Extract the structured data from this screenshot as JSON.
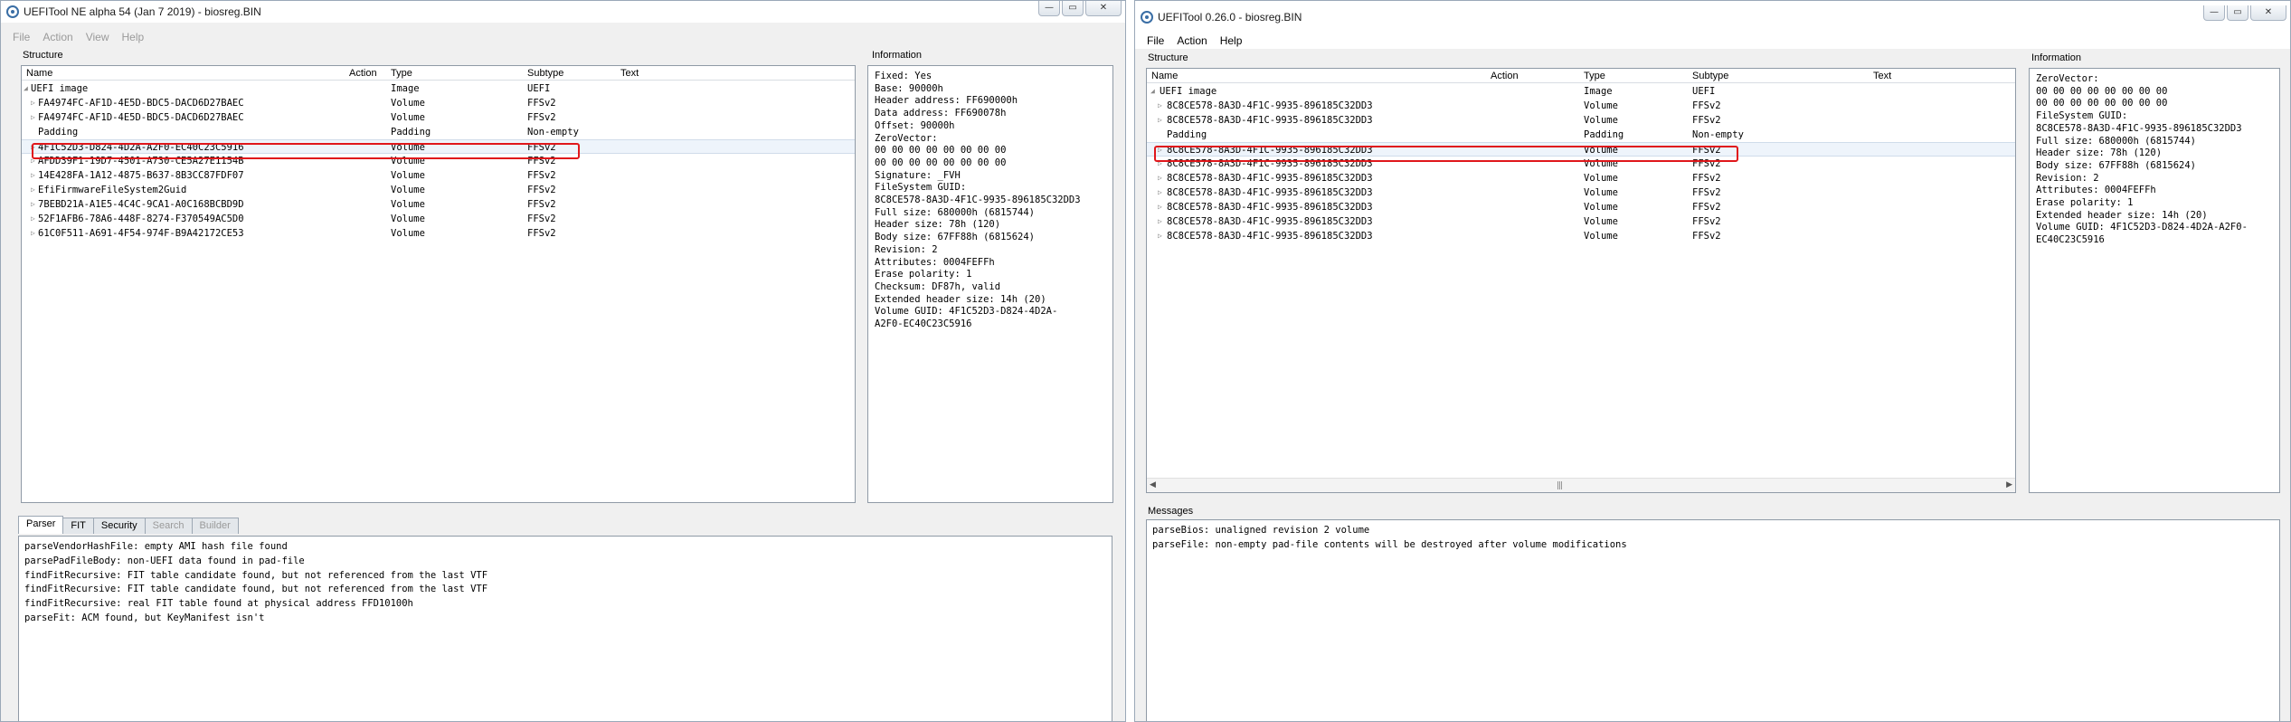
{
  "left": {
    "title": "UEFITool NE alpha 54 (Jan  7 2019) - biosreg.BIN",
    "menu": [
      "File",
      "Action",
      "View",
      "Help"
    ],
    "structure_label": "Structure",
    "information_label": "Information",
    "columns": [
      "Name",
      "Action",
      "Type",
      "Subtype",
      "Text"
    ],
    "rows": [
      {
        "name": "UEFI image",
        "type": "Image",
        "subtype": "UEFI",
        "expander": "◢"
      },
      {
        "name": "FA4974FC-AF1D-4E5D-BDC5-DACD6D27BAEC",
        "type": "Volume",
        "subtype": "FFSv2",
        "expander": "▷"
      },
      {
        "name": "FA4974FC-AF1D-4E5D-BDC5-DACD6D27BAEC",
        "type": "Volume",
        "subtype": "FFSv2",
        "expander": "▷"
      },
      {
        "name": "Padding",
        "type": "Padding",
        "subtype": "Non-empty",
        "expander": ""
      },
      {
        "name": "4F1C52D3-D824-4D2A-A2F0-EC40C23C5916",
        "type": "Volume",
        "subtype": "FFSv2",
        "expander": "▷"
      },
      {
        "name": "AFDD39F1-19D7-4501-A730-CE5A27E1154B",
        "type": "Volume",
        "subtype": "FFSv2",
        "expander": "▷"
      },
      {
        "name": "14E428FA-1A12-4875-B637-8B3CC87FDF07",
        "type": "Volume",
        "subtype": "FFSv2",
        "expander": "▷"
      },
      {
        "name": "EfiFirmwareFileSystem2Guid",
        "type": "Volume",
        "subtype": "FFSv2",
        "expander": "▷"
      },
      {
        "name": "7BEBD21A-A1E5-4C4C-9CA1-A0C168BCBD9D",
        "type": "Volume",
        "subtype": "FFSv2",
        "expander": "▷"
      },
      {
        "name": "52F1AFB6-78A6-448F-8274-F370549AC5D0",
        "type": "Volume",
        "subtype": "FFSv2",
        "expander": "▷"
      },
      {
        "name": "61C0F511-A691-4F54-974F-B9A42172CE53",
        "type": "Volume",
        "subtype": "FFSv2",
        "expander": "▷"
      }
    ],
    "info_lines": [
      "Fixed: Yes",
      "Base: 90000h",
      "Header address: FF690000h",
      "Data address: FF690078h",
      "Offset: 90000h",
      "ZeroVector:",
      "00 00 00 00 00 00 00 00",
      "00 00 00 00 00 00 00 00",
      "Signature: _FVH",
      "FileSystem GUID:",
      "8C8CE578-8A3D-4F1C-9935-896185C32DD3",
      "Full size: 680000h (6815744)",
      "Header size: 78h (120)",
      "Body size: 67FF88h (6815624)",
      "Revision: 2",
      "Attributes: 0004FEFFh",
      "Erase polarity: 1",
      "Checksum: DF87h, valid",
      "Extended header size: 14h (20)",
      "Volume GUID: 4F1C52D3-D824-4D2A-",
      "A2F0-EC40C23C5916"
    ],
    "tabs": [
      {
        "label": "Parser",
        "state": "active"
      },
      {
        "label": "FIT",
        "state": "normal"
      },
      {
        "label": "Security",
        "state": "normal"
      },
      {
        "label": "Search",
        "state": "disabled"
      },
      {
        "label": "Builder",
        "state": "disabled"
      }
    ],
    "messages": [
      "parseVendorHashFile: empty AMI hash file found",
      "parsePadFileBody: non-UEFI data found in pad-file",
      "findFitRecursive: FIT table candidate found, but not referenced from the last VTF",
      "findFitRecursive: FIT table candidate found, but not referenced from the last VTF",
      "findFitRecursive: real FIT table found at physical address FFD10100h",
      "parseFit: ACM found, but KeyManifest isn't"
    ]
  },
  "right": {
    "title": "UEFITool 0.26.0 - biosreg.BIN",
    "menu": [
      "File",
      "Action",
      "Help"
    ],
    "structure_label": "Structure",
    "information_label": "Information",
    "messages_label": "Messages",
    "columns": [
      "Name",
      "Action",
      "Type",
      "Subtype",
      "Text"
    ],
    "rows": [
      {
        "name": "UEFI image",
        "type": "Image",
        "subtype": "UEFI",
        "expander": "◢"
      },
      {
        "name": "8C8CE578-8A3D-4F1C-9935-896185C32DD3",
        "type": "Volume",
        "subtype": "FFSv2",
        "expander": "▷"
      },
      {
        "name": "8C8CE578-8A3D-4F1C-9935-896185C32DD3",
        "type": "Volume",
        "subtype": "FFSv2",
        "expander": "▷"
      },
      {
        "name": "Padding",
        "type": "Padding",
        "subtype": "Non-empty",
        "expander": ""
      },
      {
        "name": "8C8CE578-8A3D-4F1C-9935-896185C32DD3",
        "type": "Volume",
        "subtype": "FFSv2",
        "expander": "▷"
      },
      {
        "name": "8C8CE578-8A3D-4F1C-9935-896185C32DD3",
        "type": "Volume",
        "subtype": "FFSv2",
        "expander": "▷"
      },
      {
        "name": "8C8CE578-8A3D-4F1C-9935-896185C32DD3",
        "type": "Volume",
        "subtype": "FFSv2",
        "expander": "▷"
      },
      {
        "name": "8C8CE578-8A3D-4F1C-9935-896185C32DD3",
        "type": "Volume",
        "subtype": "FFSv2",
        "expander": "▷"
      },
      {
        "name": "8C8CE578-8A3D-4F1C-9935-896185C32DD3",
        "type": "Volume",
        "subtype": "FFSv2",
        "expander": "▷"
      },
      {
        "name": "8C8CE578-8A3D-4F1C-9935-896185C32DD3",
        "type": "Volume",
        "subtype": "FFSv2",
        "expander": "▷"
      },
      {
        "name": "8C8CE578-8A3D-4F1C-9935-896185C32DD3",
        "type": "Volume",
        "subtype": "FFSv2",
        "expander": "▷"
      }
    ],
    "info_lines": [
      "ZeroVector:",
      "00 00 00 00 00 00 00 00",
      "00 00 00 00 00 00 00 00",
      "FileSystem GUID:",
      "8C8CE578-8A3D-4F1C-9935-896185C32DD3",
      "Full size: 680000h (6815744)",
      "Header size: 78h (120)",
      "Body size: 67FF88h (6815624)",
      "Revision: 2",
      "Attributes: 0004FEFFh",
      "Erase polarity: 1",
      "Extended header size: 14h (20)",
      "Volume GUID: 4F1C52D3-D824-4D2A-A2F0-",
      "EC40C23C5916"
    ],
    "messages": [
      "parseBios: unaligned revision 2 volume",
      "parseFile: non-empty pad-file contents will be destroyed after volume modifications"
    ]
  },
  "window_buttons": {
    "minimize": "—",
    "maximize": "▭",
    "close": "✕"
  },
  "colors": {
    "highlight": "#e0171b",
    "frame": "#9aa8b8"
  }
}
